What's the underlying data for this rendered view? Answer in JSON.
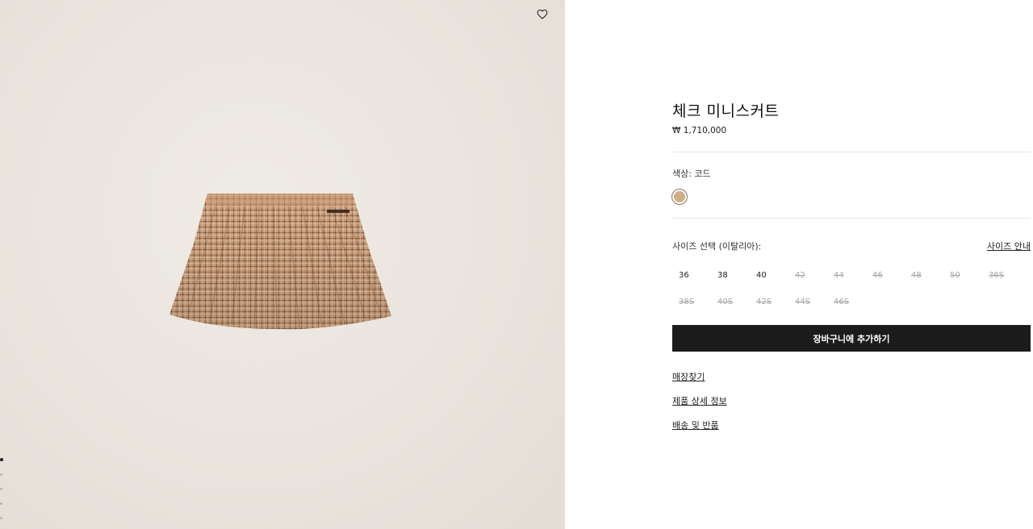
{
  "gallery": {
    "wishlist_icon": "heart-outline-icon",
    "pagination_count": 5,
    "active_index": 0
  },
  "product": {
    "title": "체크 미니스커트",
    "price": "₩ 1,710,000",
    "color_label": "색상:  코드",
    "swatch_color": "#d2ae86",
    "size_label": "사이즈 선택 (이탈리아):",
    "size_guide": "사이즈 안내",
    "sizes_row1": [
      {
        "label": "36",
        "available": true
      },
      {
        "label": "38",
        "available": true
      },
      {
        "label": "40",
        "available": true
      },
      {
        "label": "42",
        "available": false
      },
      {
        "label": "44",
        "available": false
      },
      {
        "label": "46",
        "available": false
      },
      {
        "label": "48",
        "available": false
      },
      {
        "label": "50",
        "available": false
      },
      {
        "label": "36S",
        "available": false
      }
    ],
    "sizes_row2": [
      {
        "label": "38S",
        "available": false
      },
      {
        "label": "40S",
        "available": false
      },
      {
        "label": "42S",
        "available": false
      },
      {
        "label": "44S",
        "available": false
      },
      {
        "label": "46S",
        "available": false
      }
    ],
    "add_to_cart": "장바구니에 추가하기",
    "links": {
      "store": "매장찾기",
      "details": "제품 상세 정보",
      "shipping": "배송 및 반품"
    }
  }
}
